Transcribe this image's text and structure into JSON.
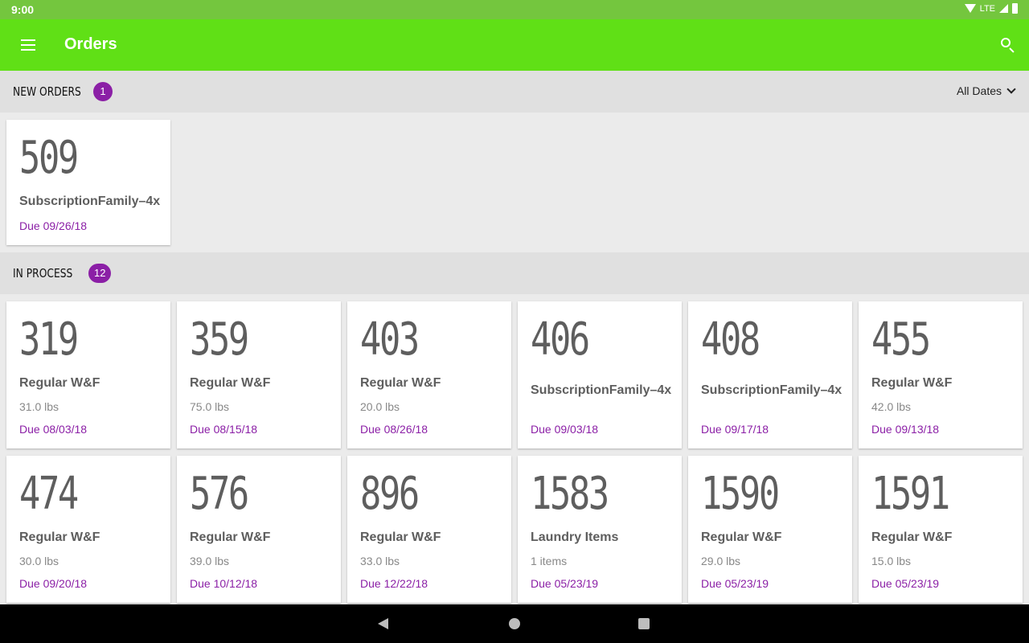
{
  "status_bar": {
    "time": "9:00",
    "network": "LTE"
  },
  "app_bar": {
    "title": "Orders",
    "menu_icon": "menu-icon",
    "search_icon": "search-icon"
  },
  "colors": {
    "status_bar": "#74c63e",
    "app_bar": "#60e016",
    "accent": "#8b1fa6"
  },
  "new_orders": {
    "title": "NEW ORDERS",
    "count": "1",
    "filter": "All Dates",
    "orders": [
      {
        "number": "509",
        "service": "SubscriptionFamily–4x",
        "due": "Due 09/26/18"
      }
    ]
  },
  "in_process": {
    "title": "IN PROCESS",
    "count": "12",
    "orders": [
      {
        "number": "319",
        "service": "Regular W&F",
        "weight": "31.0 lbs",
        "due": "Due 08/03/18"
      },
      {
        "number": "359",
        "service": "Regular W&F",
        "weight": "75.0 lbs",
        "due": "Due 08/15/18"
      },
      {
        "number": "403",
        "service": "Regular W&F",
        "weight": "20.0 lbs",
        "due": "Due 08/26/18"
      },
      {
        "number": "406",
        "service": "SubscriptionFamily–4x",
        "due": "Due 09/03/18"
      },
      {
        "number": "408",
        "service": "SubscriptionFamily–4x",
        "due": "Due 09/17/18"
      },
      {
        "number": "455",
        "service": "Regular W&F",
        "weight": "42.0 lbs",
        "due": "Due 09/13/18"
      },
      {
        "number": "474",
        "service": "Regular W&F",
        "weight": "30.0 lbs",
        "due": "Due 09/20/18"
      },
      {
        "number": "576",
        "service": "Regular W&F",
        "weight": "39.0 lbs",
        "due": "Due 10/12/18"
      },
      {
        "number": "896",
        "service": "Regular W&F",
        "weight": "33.0 lbs",
        "due": "Due 12/22/18"
      },
      {
        "number": "1583",
        "service": "Laundry Items",
        "weight": "1 items",
        "due": "Due 05/23/19"
      },
      {
        "number": "1590",
        "service": "Regular W&F",
        "weight": "29.0 lbs",
        "due": "Due 05/23/19"
      },
      {
        "number": "1591",
        "service": "Regular W&F",
        "weight": "15.0 lbs",
        "due": "Due 05/23/19"
      }
    ]
  }
}
